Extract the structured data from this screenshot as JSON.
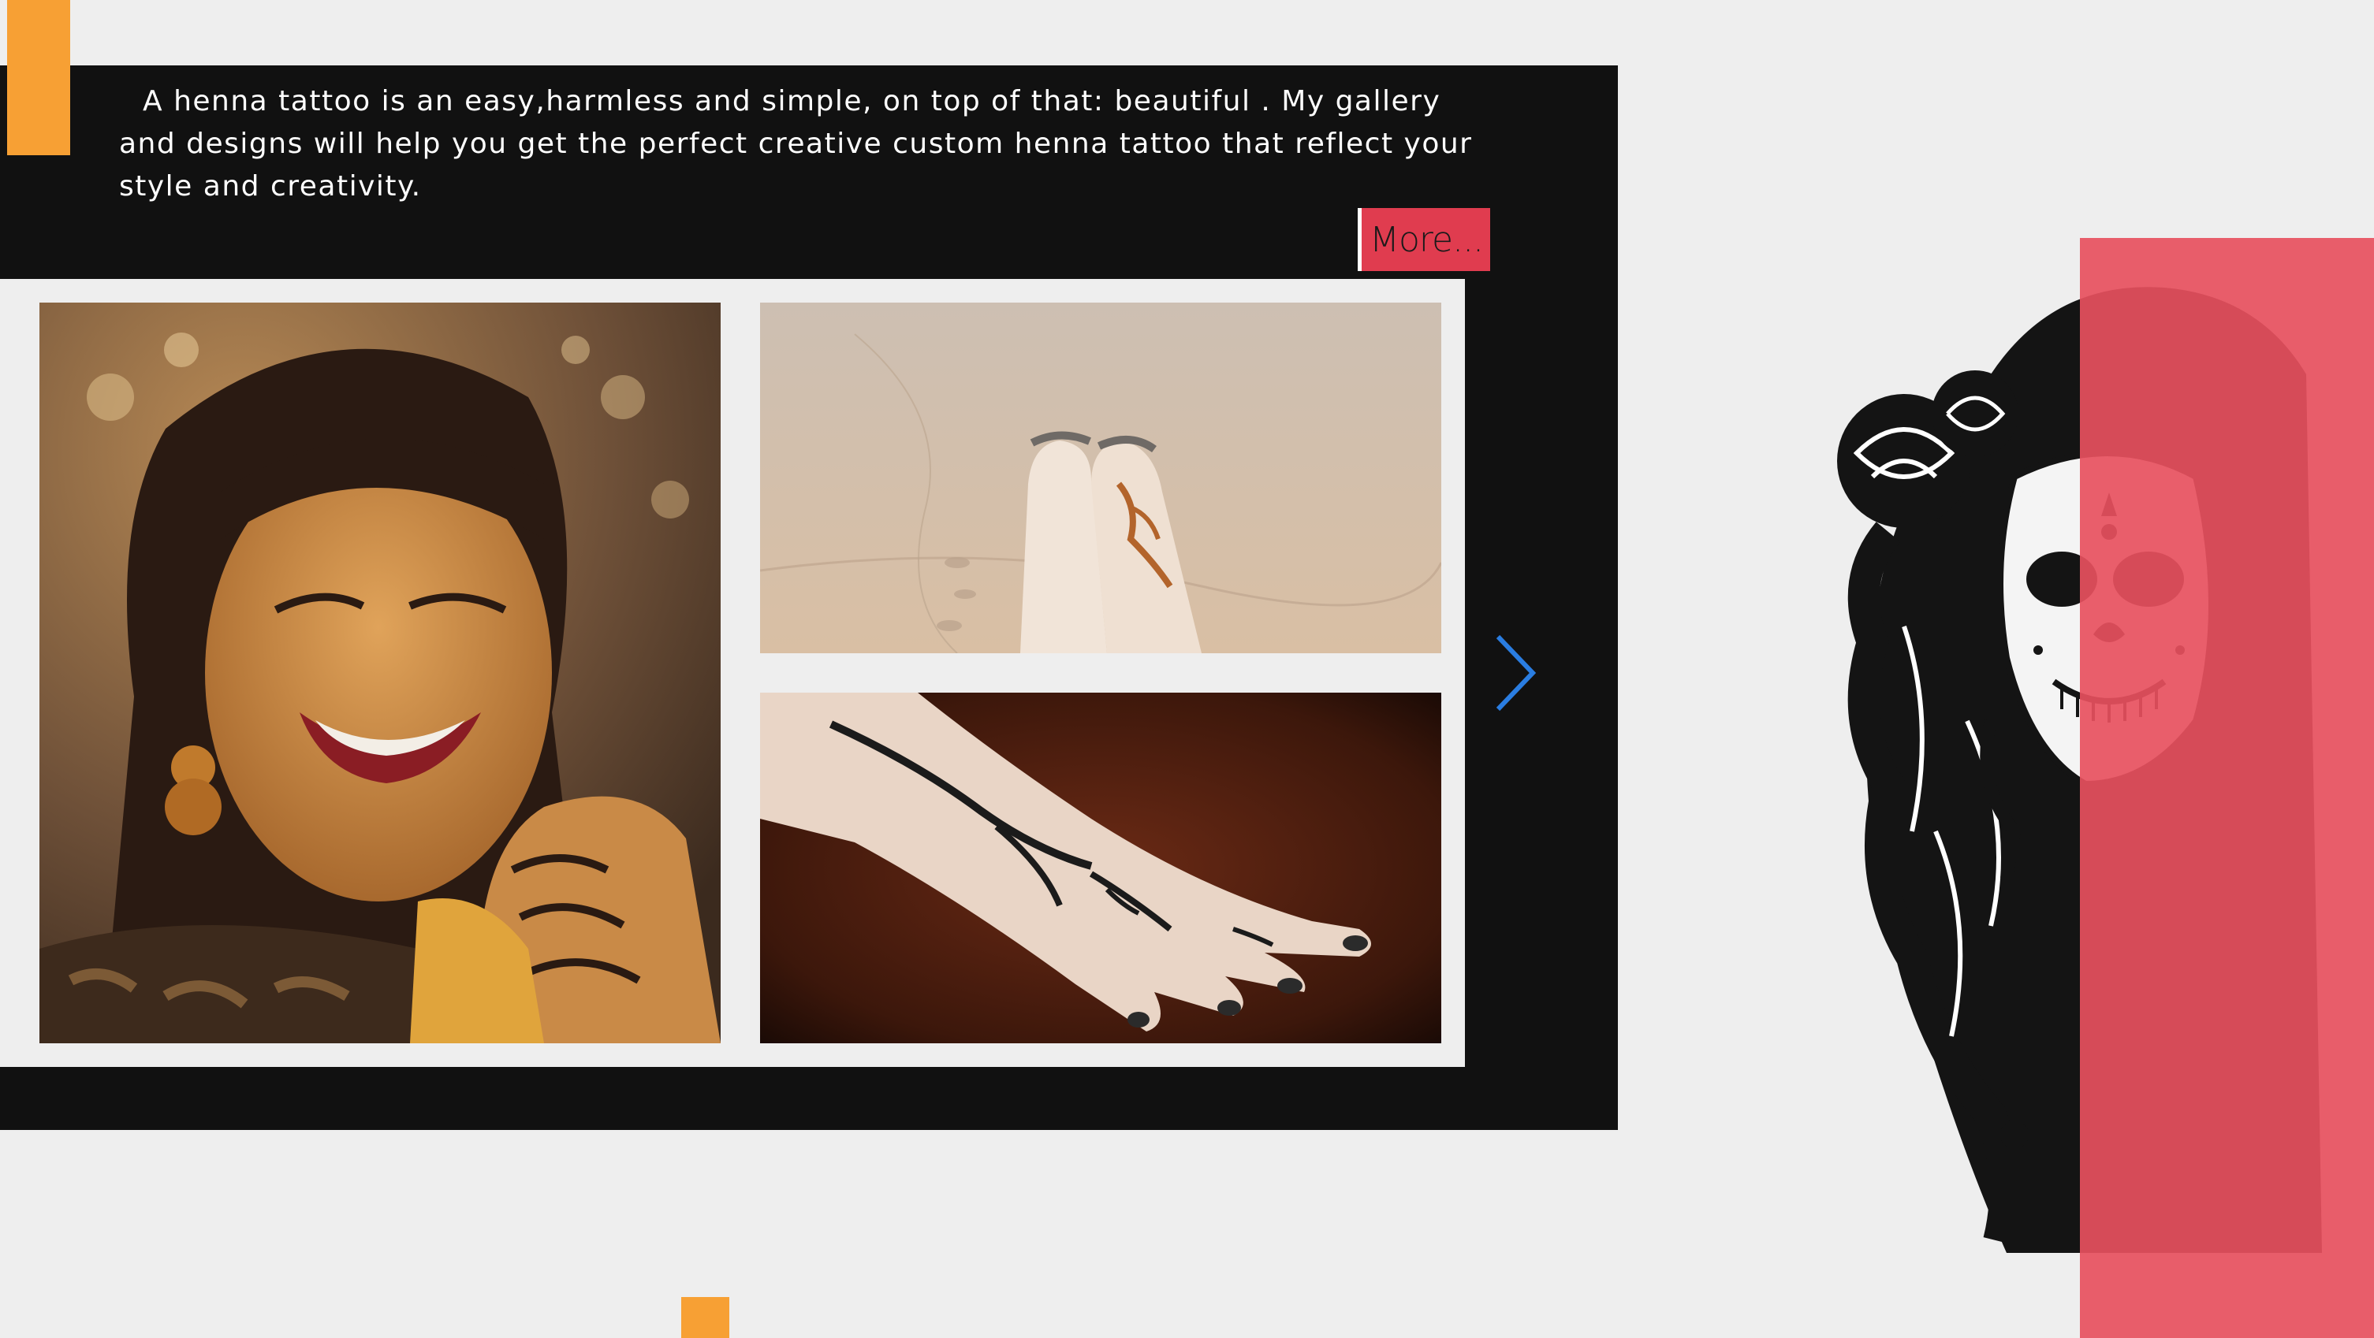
{
  "intro": {
    "text": "A henna tattoo is an easy,harmless and simple, on top of that: beautiful . My gallery and designs will help you get the perfect creative custom henna tattoo that reflect your style and creativity."
  },
  "more_button": {
    "label": "More..."
  },
  "gallery": {
    "images": [
      {
        "name": "woman-with-henna-hands"
      },
      {
        "name": "feet-with-henna-in-sand"
      },
      {
        "name": "hand-with-henna-on-wood"
      }
    ],
    "next_icon": "chevron-right-icon"
  },
  "colors": {
    "accent_orange": "#f7a034",
    "panel_black": "#111111",
    "button_red": "#e03c4f",
    "overlay_pink": "#e7505e",
    "arrow_blue": "#2a7de1",
    "background": "#eeeeee"
  }
}
